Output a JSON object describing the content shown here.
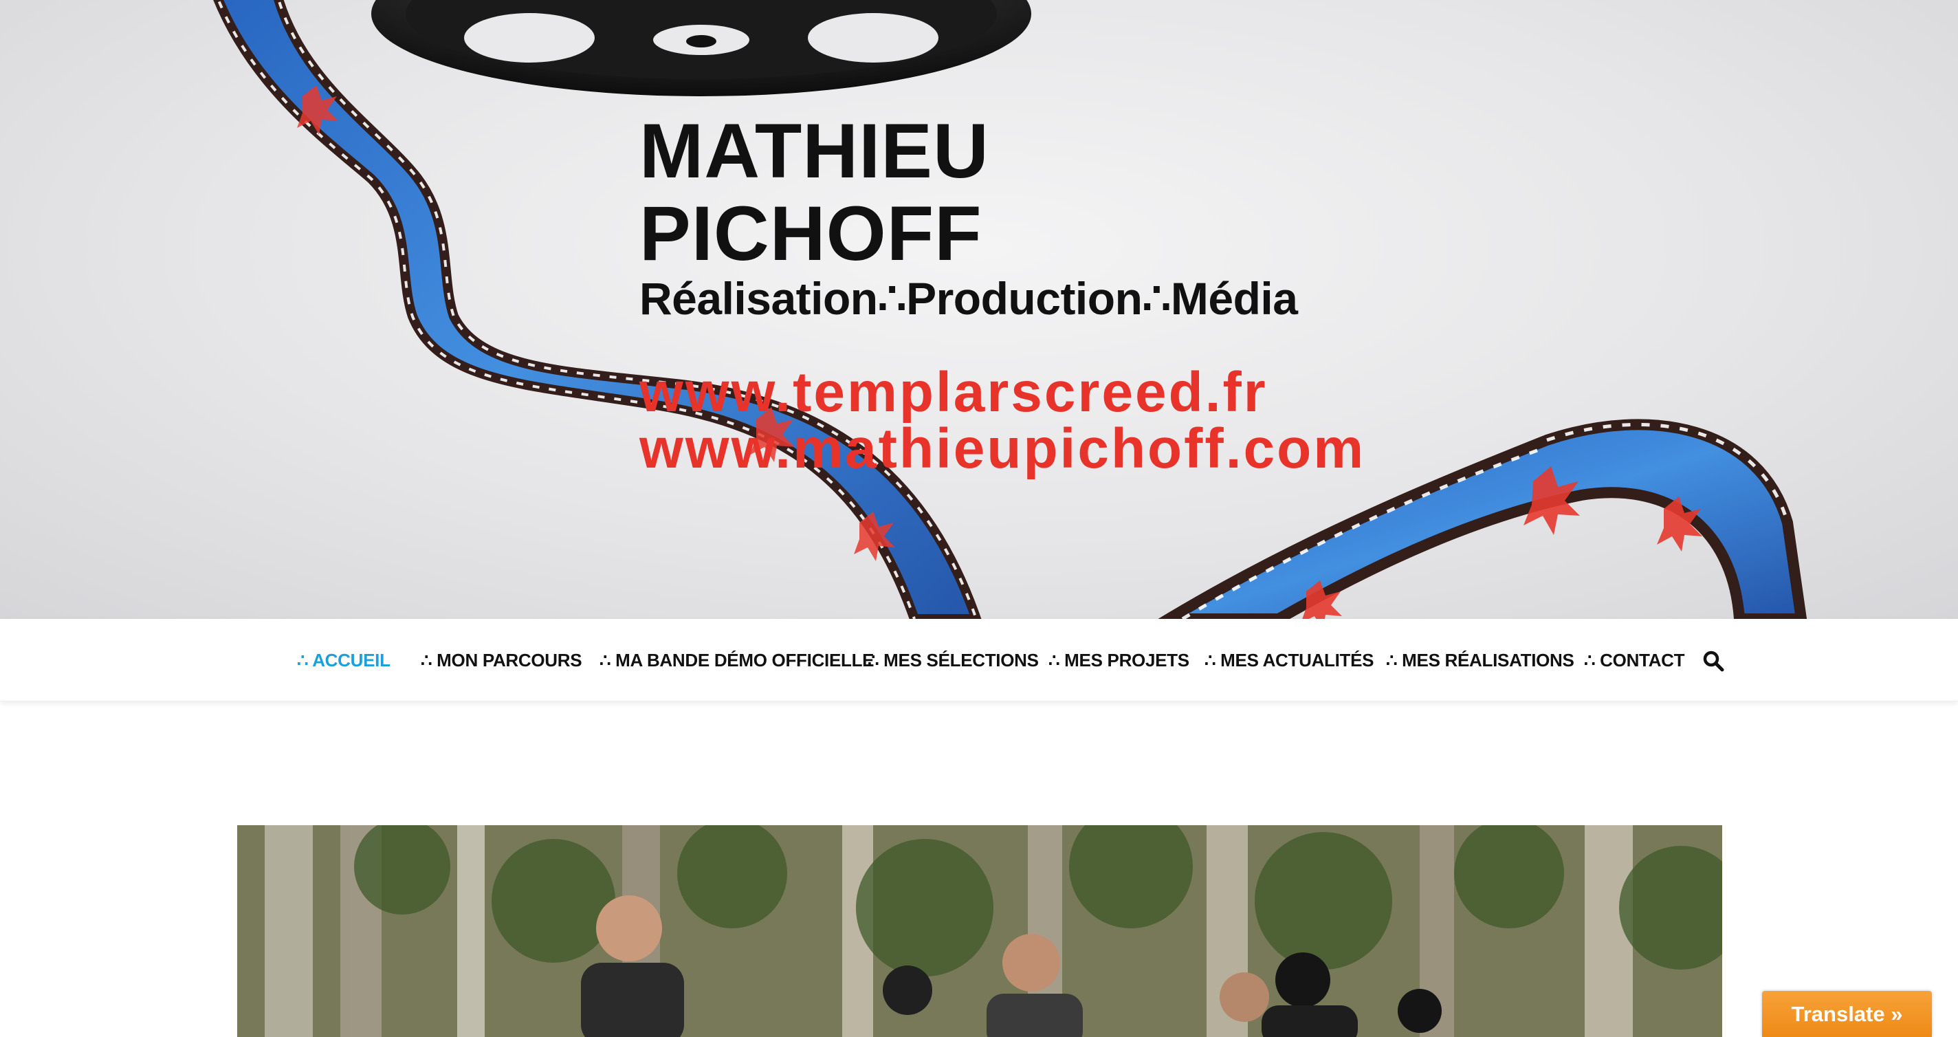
{
  "banner": {
    "name": "MATHIEU PICHOFF",
    "tagline": "Réalisation∴Production∴Média",
    "url_primary": "www.templarscreed.fr",
    "url_secondary": "www.mathieupichoff.com"
  },
  "nav": {
    "items": [
      {
        "label": "∴ ACCUEIL",
        "active": true
      },
      {
        "label": "∴ MON PARCOURS",
        "active": false
      },
      {
        "label": "∴ MA BANDE DÉMO OFFICIELLE",
        "active": false
      },
      {
        "label": "∴ MES SÉLECTIONS",
        "active": false
      },
      {
        "label": "∴ MES PROJETS",
        "active": false
      },
      {
        "label": "∴ MES ACTUALITÉS",
        "active": false
      },
      {
        "label": "∴ MES RÉALISATIONS",
        "active": false
      },
      {
        "label": "∴ CONTACT",
        "active": false
      }
    ],
    "search_icon": "search-icon"
  },
  "translate": {
    "label": "Translate »"
  },
  "colors": {
    "accent": "#1aa0dc",
    "url_red": "#e8332b",
    "translate_orange": "#f39c2b"
  }
}
